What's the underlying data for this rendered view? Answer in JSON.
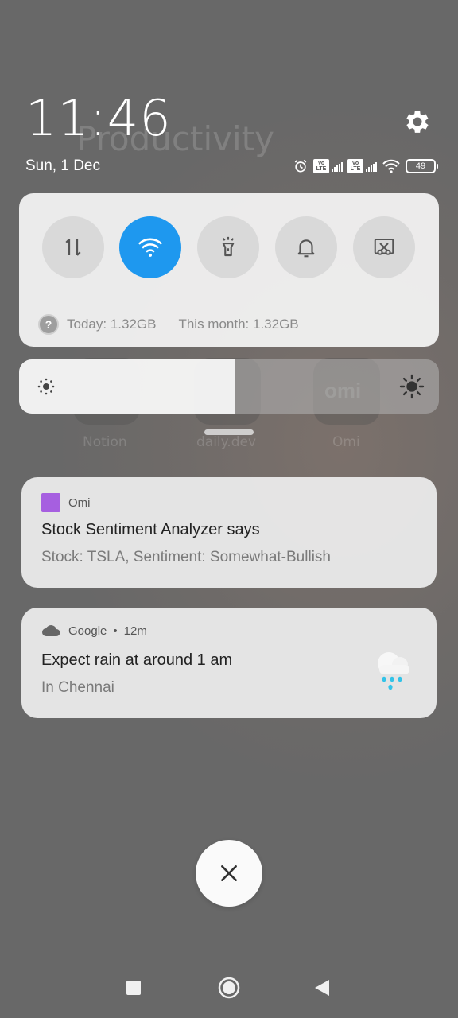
{
  "header": {
    "time": "11:46",
    "date": "Sun, 1 Dec",
    "battery": "49"
  },
  "background": {
    "folder_name": "Productivity",
    "apps": [
      {
        "label": "Notion"
      },
      {
        "label": "daily.dev"
      },
      {
        "label": "Omi",
        "icon_text": "omi"
      }
    ]
  },
  "quick_settings": {
    "toggles": [
      {
        "name": "mobile-data",
        "icon": "arrows-up-down-icon",
        "active": false
      },
      {
        "name": "wifi",
        "icon": "wifi-icon",
        "active": true
      },
      {
        "name": "flashlight",
        "icon": "flashlight-icon",
        "active": false
      },
      {
        "name": "sound",
        "icon": "bell-icon",
        "active": false
      },
      {
        "name": "screenshot",
        "icon": "scissors-icon",
        "active": false
      }
    ],
    "data_today": "Today: 1.32GB",
    "data_month": "This month: 1.32GB",
    "accent_color": "#1e98ef"
  },
  "brightness": {
    "level_fraction": 0.515
  },
  "notifications": [
    {
      "app": "Omi",
      "app_color": "#a65fe0",
      "title": "Stock Sentiment Analyzer says",
      "body": "Stock: TSLA, Sentiment: Somewhat-Bullish"
    },
    {
      "app": "Google",
      "time": "12m",
      "separator": "•",
      "title": "Expect rain at around 1 am",
      "body": "In Chennai",
      "icon": "rain-cloud-icon"
    }
  ]
}
